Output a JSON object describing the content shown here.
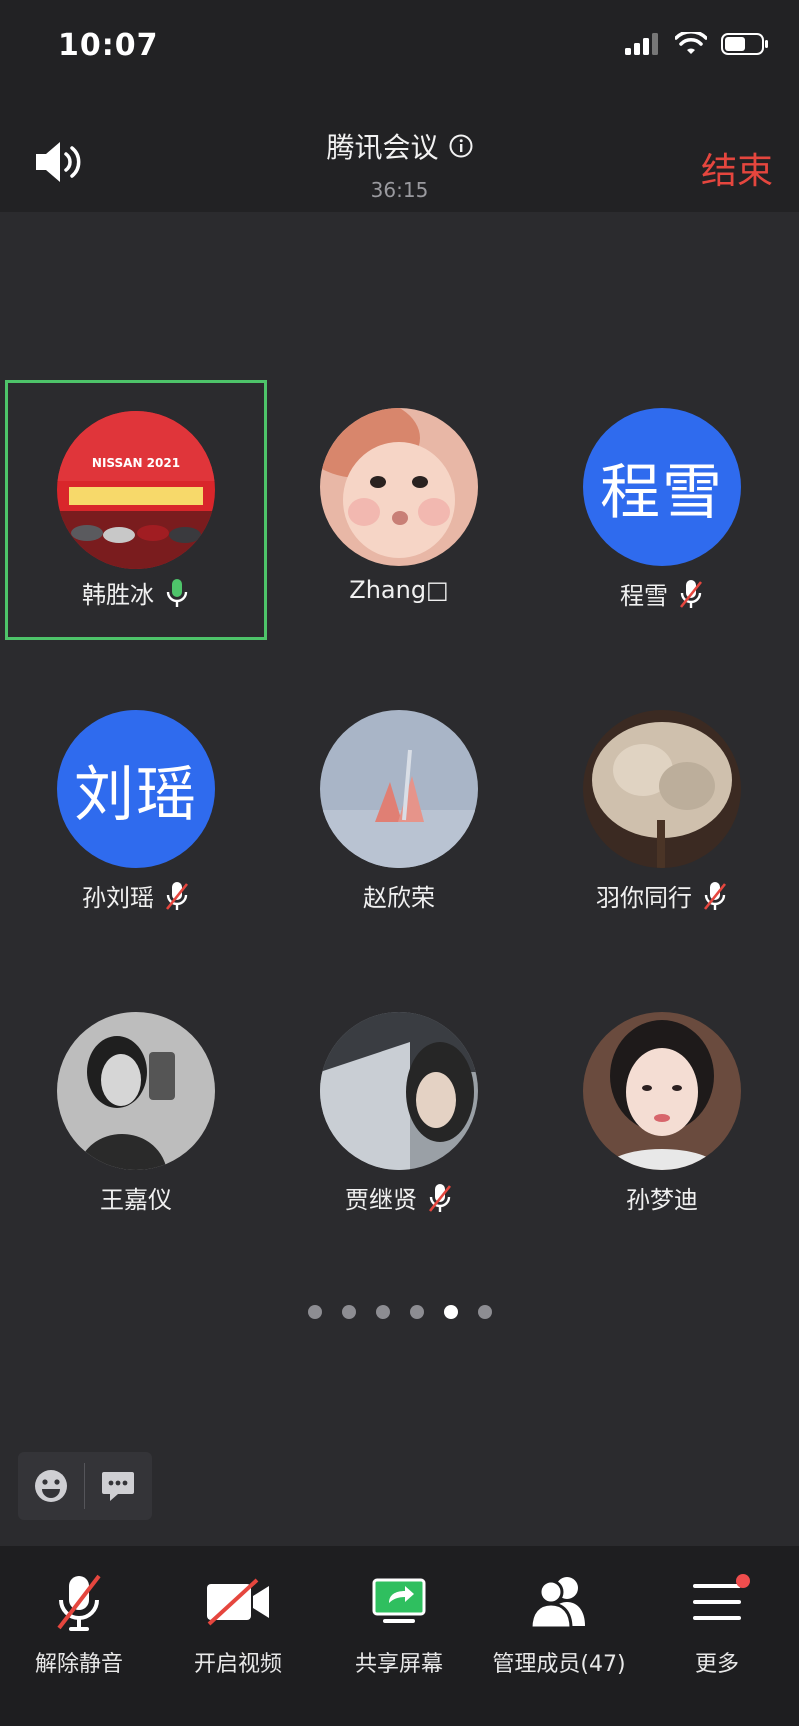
{
  "status": {
    "time": "10:07"
  },
  "header": {
    "title": "腾讯会议",
    "timer": "36:15",
    "end_label": "结束"
  },
  "participants": [
    {
      "name": "韩胜冰",
      "avatar_text": "",
      "mic": "on",
      "active": true
    },
    {
      "name": "Zhang□",
      "avatar_text": "",
      "mic": "none",
      "active": false
    },
    {
      "name": "程雪",
      "avatar_text": "程雪",
      "mic": "muted",
      "active": false
    },
    {
      "name": "孙刘瑶",
      "avatar_text": "刘瑶",
      "mic": "muted",
      "active": false
    },
    {
      "name": "赵欣荣",
      "avatar_text": "",
      "mic": "none",
      "active": false
    },
    {
      "name": "羽你同行",
      "avatar_text": "",
      "mic": "muted",
      "active": false
    },
    {
      "name": "王嘉仪",
      "avatar_text": "",
      "mic": "none",
      "active": false
    },
    {
      "name": "贾继贤",
      "avatar_text": "",
      "mic": "muted",
      "active": false
    },
    {
      "name": "孙梦迪",
      "avatar_text": "",
      "mic": "none",
      "active": false
    }
  ],
  "pagination": {
    "total": 6,
    "current": 5
  },
  "toolbar": {
    "unmute_label": "解除静音",
    "video_label": "开启视频",
    "share_label": "共享屏幕",
    "members_label": "管理成员(47)",
    "more_label": "更多"
  },
  "colors": {
    "accent_green": "#4ec46a",
    "end_red": "#e5463e",
    "avatar_blue": "#2f6bee"
  },
  "icons": [
    "speaker-icon",
    "info-icon",
    "mic-icon",
    "mic-muted-icon",
    "emoji-icon",
    "chat-icon",
    "video-off-icon",
    "share-screen-icon",
    "members-icon",
    "menu-icon"
  ]
}
